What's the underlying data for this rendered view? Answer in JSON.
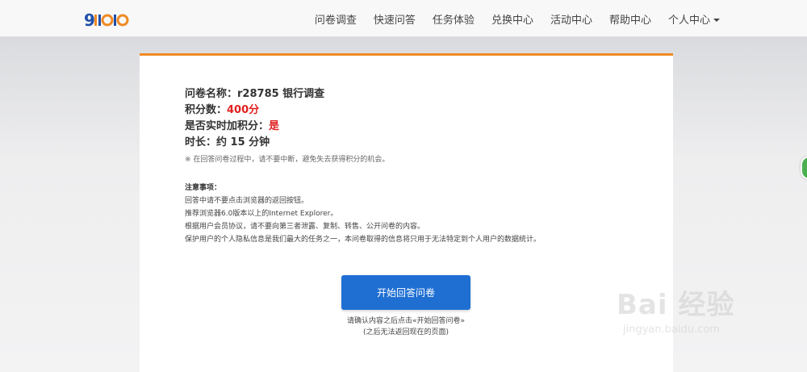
{
  "header": {
    "logo_text": "91问问",
    "nav": [
      {
        "label": "问卷调查"
      },
      {
        "label": "快速问答"
      },
      {
        "label": "任务体验"
      },
      {
        "label": "兑换中心"
      },
      {
        "label": "活动中心"
      },
      {
        "label": "帮助中心"
      },
      {
        "label": "个人中心",
        "has_dropdown": true
      }
    ]
  },
  "survey": {
    "name_label": "问卷名称：",
    "name_value": "r28785 银行调查",
    "points_label": "积分数：",
    "points_value": "400分",
    "realtime_label": "是否实时加积分：",
    "realtime_value": "是",
    "duration_label": "时长：",
    "duration_value": "约 15 分钟",
    "tip": "※ 在回答问卷过程中，请不要中断，避免失去获得积分的机会。"
  },
  "notice": {
    "title": "注意事项：",
    "items": [
      "回答中请不要点击浏览器的返回按钮。",
      "推荐浏览器6.0版本以上的Internet Explorer。",
      "根据用户会员协议，请不要向第三者泄露、复制、转售、公开问卷的内容。",
      "保护用户的个人隐私信息是我们最大的任务之一，本问卷取得的信息将只用于无法特定到个人用户的数据统计。"
    ]
  },
  "start_button": {
    "label": "开始回答问卷"
  },
  "confirm": {
    "line1": "请确认内容之后点击«开始回答问卷»",
    "line2": "(之后无法返回现在的页面)"
  },
  "watermark": {
    "text": "Bai  经验",
    "url": "jingyan.baidu.com"
  },
  "colors": {
    "accent_orange": "#f08a24",
    "button_blue": "#1f6fd3",
    "highlight_red": "#e02020"
  }
}
